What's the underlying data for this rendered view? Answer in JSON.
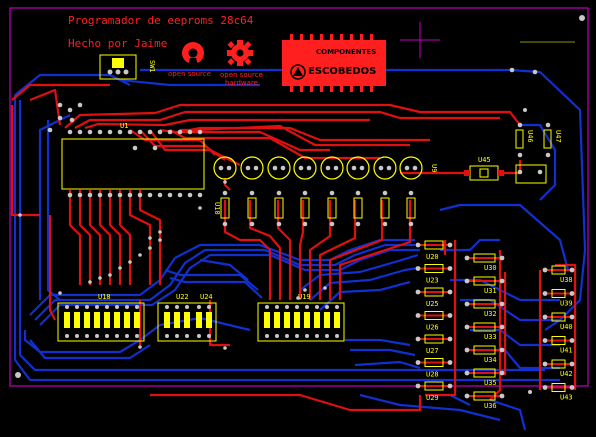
{
  "board": {
    "title": "Programador de eeproms 28c64",
    "subtitle": "Hecho por Jaime",
    "colors": {
      "background": "#000000",
      "top_copper": "#e01010",
      "bottom_copper": "#1030d0",
      "silkscreen": "#ffff00",
      "outline": "#c000c0",
      "pad": "#c8c8c8"
    }
  },
  "logos": {
    "osi_label": "open source",
    "osh_label_1": "open source",
    "osh_label_2": "hardware",
    "brand_top": "COMPONENTES",
    "brand_bottom": "ESCOBEDOS"
  },
  "components": {
    "switch": "SW1",
    "u1": "U1",
    "u9": "U9",
    "u10": "U10",
    "u18": "U18",
    "u19": "U19",
    "u22": "U22",
    "u24": "U24",
    "u45": "U45",
    "u46": "U46",
    "u47": "U47",
    "left_resistors": [
      "U20",
      "U23",
      "U25",
      "U26",
      "U27",
      "U28",
      "U29"
    ],
    "mid_resistors": [
      "U30",
      "U31",
      "U32",
      "U33",
      "U34",
      "U35",
      "U36"
    ],
    "right_resistors": [
      "U38",
      "U39",
      "U40",
      "U41",
      "U42",
      "U43"
    ]
  }
}
